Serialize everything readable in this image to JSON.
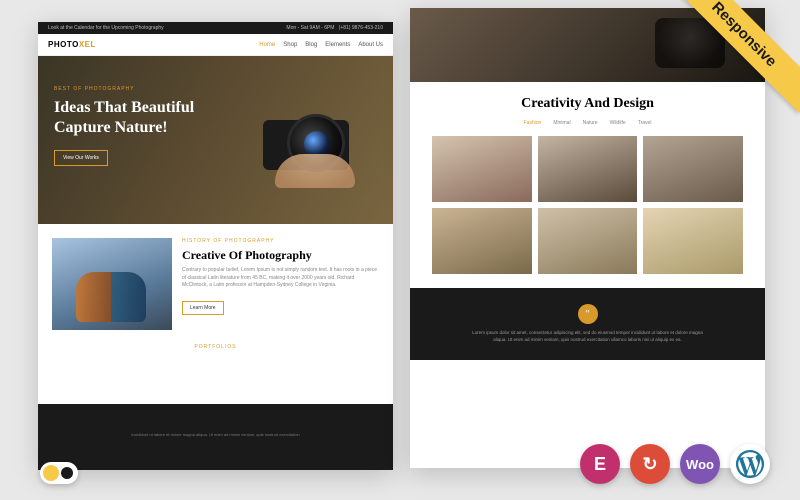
{
  "ribbon": {
    "label": "Responsive"
  },
  "left": {
    "topbar": {
      "left": "Look at the Calendar for the Upcoming Photography",
      "right_hours": "Mon - Sat 9AM - 6PM",
      "right_phone": "(+81) 9876-453-210"
    },
    "logo": {
      "part1": "PHOTO",
      "part2": "XEL"
    },
    "nav": {
      "home": "Home",
      "shop": "Shop",
      "blog": "Blog",
      "elements": "Elements",
      "about": "About Us"
    },
    "hero": {
      "kicker": "BEST OF PHOTOGRAPHY",
      "title": "Ideas That Beautiful Capture Nature!",
      "button": "View Our Works"
    },
    "about": {
      "kicker": "HISTORY OF PHOTOGRAPHY",
      "title": "Creative Of Photography",
      "body": "Contrary to popular belief, Lorem Ipsum is not simply random text. It has roots in a piece of classical Latin literature from 45 BC, making it over 2000 years old. Richard McClintock, a Latin professor at Hampden-Sydney College in Virginia.",
      "button": "Learn More"
    },
    "portfolios_kicker": "PORTFOLIOS",
    "footer_text": "incididunt ut labore et dolore magna aliqua. Ut enim ad minim veniam, quis nostrud exercitation"
  },
  "right": {
    "gallery_title": "Creativity And Design",
    "tabs": {
      "t1": "Fashion",
      "t2": "Minimal",
      "t3": "Nature",
      "t4": "Wildlife",
      "t5": "Travel"
    },
    "quote": "Lorem ipsum dolor sit amet, consectetur adipiscing elit, sed do eiusmod tempor incididunt ut labore et dolore magna aliqua. Ut enim ad minim veniam, quis nostrud exercitation ullamco laboris nisi ut aliquip ex ea."
  },
  "icons": {
    "elementor": "E",
    "refresh": "↻",
    "woo": "Woo"
  }
}
